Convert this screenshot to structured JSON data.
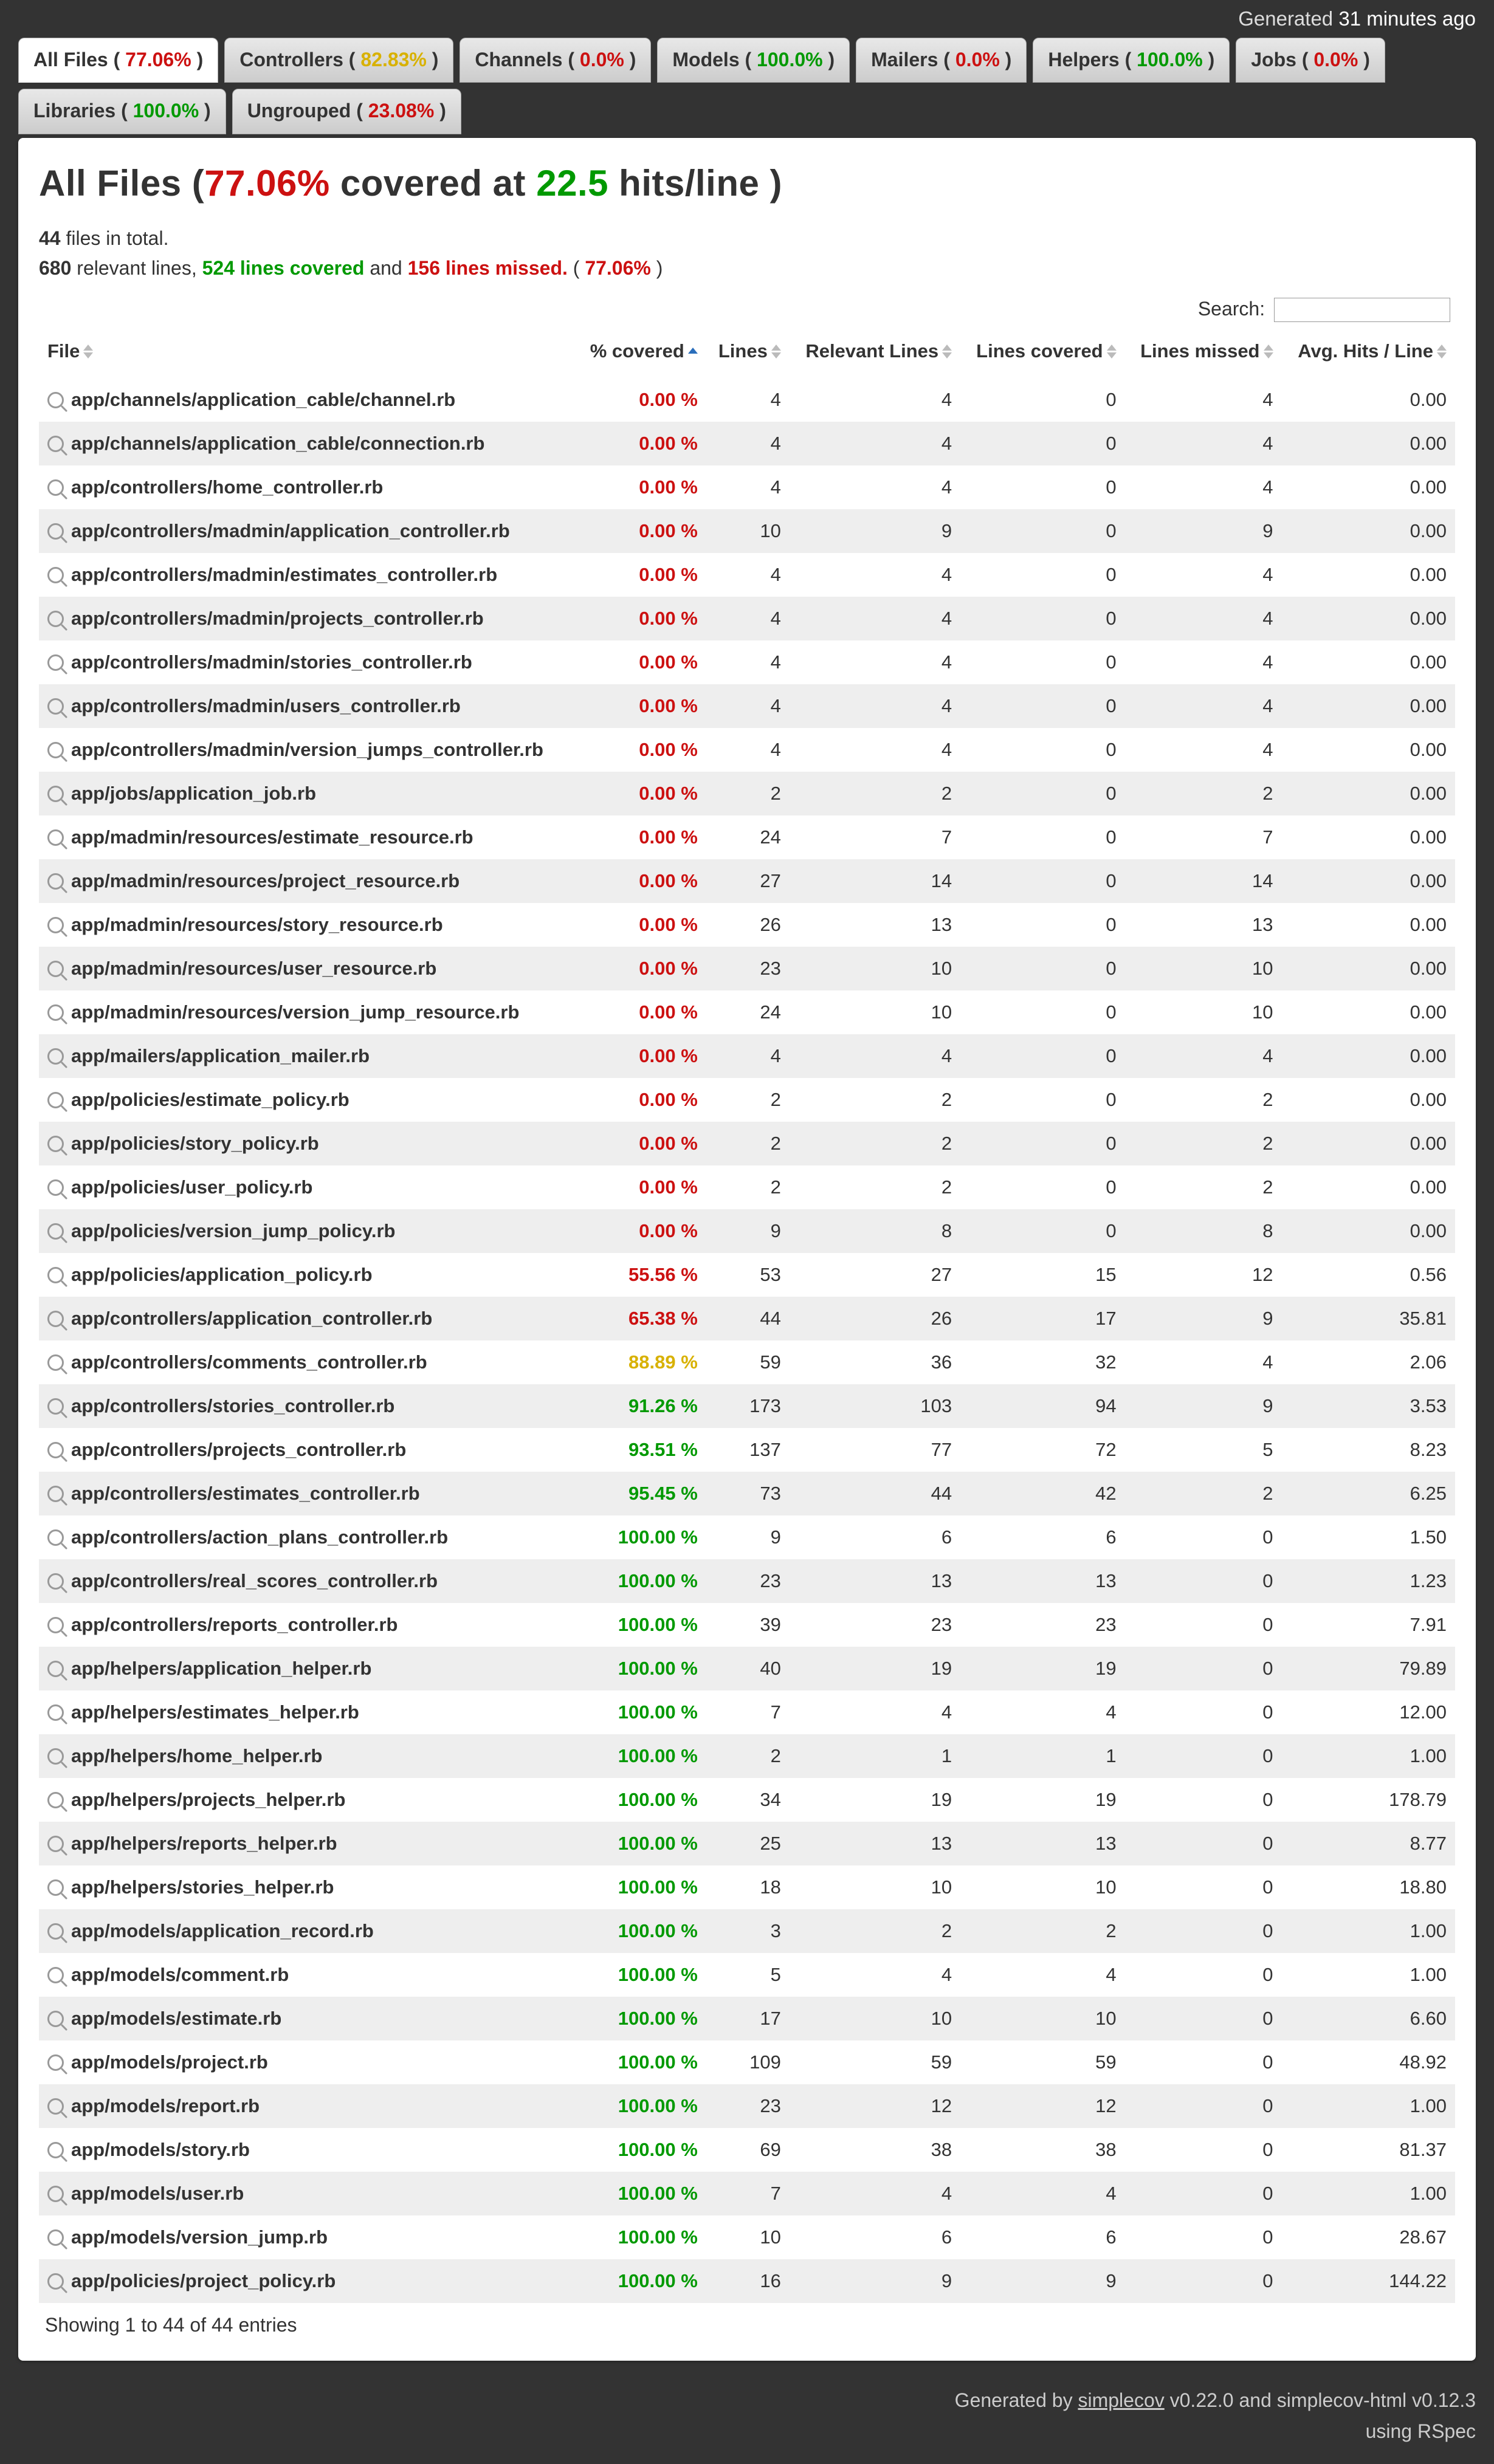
{
  "timestamp": {
    "prefix": "Generated",
    "ago": "31 minutes ago"
  },
  "tabs": [
    {
      "label": "All Files",
      "pct": "77.06%",
      "cls": "pct-red",
      "active": true
    },
    {
      "label": "Controllers",
      "pct": "82.83%",
      "cls": "pct-yellow"
    },
    {
      "label": "Channels",
      "pct": "0.0%",
      "cls": "pct-red"
    },
    {
      "label": "Models",
      "pct": "100.0%",
      "cls": "pct-green"
    },
    {
      "label": "Mailers",
      "pct": "0.0%",
      "cls": "pct-red"
    },
    {
      "label": "Helpers",
      "pct": "100.0%",
      "cls": "pct-green"
    },
    {
      "label": "Jobs",
      "pct": "0.0%",
      "cls": "pct-red"
    },
    {
      "label": "Libraries",
      "pct": "100.0%",
      "cls": "pct-green"
    },
    {
      "label": "Ungrouped",
      "pct": "23.08%",
      "cls": "pct-red"
    }
  ],
  "title": {
    "part1": "All Files (",
    "pct": "77.06%",
    "part2": " covered at ",
    "hits": "22.5",
    "part3": " hits/line )"
  },
  "sub1": {
    "count": "44",
    "suffix": " files in total."
  },
  "sub2": {
    "relevant": "680",
    "relevant_text": " relevant lines, ",
    "covered": "524 lines covered",
    "mid": " and ",
    "missed": "156 lines missed.",
    "tail_open": " ( ",
    "tail_pct": "77.06%",
    "tail_close": " )"
  },
  "search_label": "Search:",
  "columns": [
    "File",
    "% covered",
    "Lines",
    "Relevant Lines",
    "Lines covered",
    "Lines missed",
    "Avg. Hits / Line"
  ],
  "rows": [
    {
      "file": "app/channels/application_cable/channel.rb",
      "pct": "0.00 %",
      "pcls": "pct-red",
      "lines": "4",
      "rel": "4",
      "cov": "0",
      "miss": "4",
      "hits": "0.00"
    },
    {
      "file": "app/channels/application_cable/connection.rb",
      "pct": "0.00 %",
      "pcls": "pct-red",
      "lines": "4",
      "rel": "4",
      "cov": "0",
      "miss": "4",
      "hits": "0.00"
    },
    {
      "file": "app/controllers/home_controller.rb",
      "pct": "0.00 %",
      "pcls": "pct-red",
      "lines": "4",
      "rel": "4",
      "cov": "0",
      "miss": "4",
      "hits": "0.00"
    },
    {
      "file": "app/controllers/madmin/application_controller.rb",
      "pct": "0.00 %",
      "pcls": "pct-red",
      "lines": "10",
      "rel": "9",
      "cov": "0",
      "miss": "9",
      "hits": "0.00"
    },
    {
      "file": "app/controllers/madmin/estimates_controller.rb",
      "pct": "0.00 %",
      "pcls": "pct-red",
      "lines": "4",
      "rel": "4",
      "cov": "0",
      "miss": "4",
      "hits": "0.00"
    },
    {
      "file": "app/controllers/madmin/projects_controller.rb",
      "pct": "0.00 %",
      "pcls": "pct-red",
      "lines": "4",
      "rel": "4",
      "cov": "0",
      "miss": "4",
      "hits": "0.00"
    },
    {
      "file": "app/controllers/madmin/stories_controller.rb",
      "pct": "0.00 %",
      "pcls": "pct-red",
      "lines": "4",
      "rel": "4",
      "cov": "0",
      "miss": "4",
      "hits": "0.00"
    },
    {
      "file": "app/controllers/madmin/users_controller.rb",
      "pct": "0.00 %",
      "pcls": "pct-red",
      "lines": "4",
      "rel": "4",
      "cov": "0",
      "miss": "4",
      "hits": "0.00"
    },
    {
      "file": "app/controllers/madmin/version_jumps_controller.rb",
      "pct": "0.00 %",
      "pcls": "pct-red",
      "lines": "4",
      "rel": "4",
      "cov": "0",
      "miss": "4",
      "hits": "0.00"
    },
    {
      "file": "app/jobs/application_job.rb",
      "pct": "0.00 %",
      "pcls": "pct-red",
      "lines": "2",
      "rel": "2",
      "cov": "0",
      "miss": "2",
      "hits": "0.00"
    },
    {
      "file": "app/madmin/resources/estimate_resource.rb",
      "pct": "0.00 %",
      "pcls": "pct-red",
      "lines": "24",
      "rel": "7",
      "cov": "0",
      "miss": "7",
      "hits": "0.00"
    },
    {
      "file": "app/madmin/resources/project_resource.rb",
      "pct": "0.00 %",
      "pcls": "pct-red",
      "lines": "27",
      "rel": "14",
      "cov": "0",
      "miss": "14",
      "hits": "0.00"
    },
    {
      "file": "app/madmin/resources/story_resource.rb",
      "pct": "0.00 %",
      "pcls": "pct-red",
      "lines": "26",
      "rel": "13",
      "cov": "0",
      "miss": "13",
      "hits": "0.00"
    },
    {
      "file": "app/madmin/resources/user_resource.rb",
      "pct": "0.00 %",
      "pcls": "pct-red",
      "lines": "23",
      "rel": "10",
      "cov": "0",
      "miss": "10",
      "hits": "0.00"
    },
    {
      "file": "app/madmin/resources/version_jump_resource.rb",
      "pct": "0.00 %",
      "pcls": "pct-red",
      "lines": "24",
      "rel": "10",
      "cov": "0",
      "miss": "10",
      "hits": "0.00"
    },
    {
      "file": "app/mailers/application_mailer.rb",
      "pct": "0.00 %",
      "pcls": "pct-red",
      "lines": "4",
      "rel": "4",
      "cov": "0",
      "miss": "4",
      "hits": "0.00"
    },
    {
      "file": "app/policies/estimate_policy.rb",
      "pct": "0.00 %",
      "pcls": "pct-red",
      "lines": "2",
      "rel": "2",
      "cov": "0",
      "miss": "2",
      "hits": "0.00"
    },
    {
      "file": "app/policies/story_policy.rb",
      "pct": "0.00 %",
      "pcls": "pct-red",
      "lines": "2",
      "rel": "2",
      "cov": "0",
      "miss": "2",
      "hits": "0.00"
    },
    {
      "file": "app/policies/user_policy.rb",
      "pct": "0.00 %",
      "pcls": "pct-red",
      "lines": "2",
      "rel": "2",
      "cov": "0",
      "miss": "2",
      "hits": "0.00"
    },
    {
      "file": "app/policies/version_jump_policy.rb",
      "pct": "0.00 %",
      "pcls": "pct-red",
      "lines": "9",
      "rel": "8",
      "cov": "0",
      "miss": "8",
      "hits": "0.00"
    },
    {
      "file": "app/policies/application_policy.rb",
      "pct": "55.56 %",
      "pcls": "pct-red",
      "lines": "53",
      "rel": "27",
      "cov": "15",
      "miss": "12",
      "hits": "0.56"
    },
    {
      "file": "app/controllers/application_controller.rb",
      "pct": "65.38 %",
      "pcls": "pct-red",
      "lines": "44",
      "rel": "26",
      "cov": "17",
      "miss": "9",
      "hits": "35.81"
    },
    {
      "file": "app/controllers/comments_controller.rb",
      "pct": "88.89 %",
      "pcls": "pct-yellow",
      "lines": "59",
      "rel": "36",
      "cov": "32",
      "miss": "4",
      "hits": "2.06"
    },
    {
      "file": "app/controllers/stories_controller.rb",
      "pct": "91.26 %",
      "pcls": "pct-green",
      "lines": "173",
      "rel": "103",
      "cov": "94",
      "miss": "9",
      "hits": "3.53"
    },
    {
      "file": "app/controllers/projects_controller.rb",
      "pct": "93.51 %",
      "pcls": "pct-green",
      "lines": "137",
      "rel": "77",
      "cov": "72",
      "miss": "5",
      "hits": "8.23"
    },
    {
      "file": "app/controllers/estimates_controller.rb",
      "pct": "95.45 %",
      "pcls": "pct-green",
      "lines": "73",
      "rel": "44",
      "cov": "42",
      "miss": "2",
      "hits": "6.25"
    },
    {
      "file": "app/controllers/action_plans_controller.rb",
      "pct": "100.00 %",
      "pcls": "pct-green",
      "lines": "9",
      "rel": "6",
      "cov": "6",
      "miss": "0",
      "hits": "1.50"
    },
    {
      "file": "app/controllers/real_scores_controller.rb",
      "pct": "100.00 %",
      "pcls": "pct-green",
      "lines": "23",
      "rel": "13",
      "cov": "13",
      "miss": "0",
      "hits": "1.23"
    },
    {
      "file": "app/controllers/reports_controller.rb",
      "pct": "100.00 %",
      "pcls": "pct-green",
      "lines": "39",
      "rel": "23",
      "cov": "23",
      "miss": "0",
      "hits": "7.91"
    },
    {
      "file": "app/helpers/application_helper.rb",
      "pct": "100.00 %",
      "pcls": "pct-green",
      "lines": "40",
      "rel": "19",
      "cov": "19",
      "miss": "0",
      "hits": "79.89"
    },
    {
      "file": "app/helpers/estimates_helper.rb",
      "pct": "100.00 %",
      "pcls": "pct-green",
      "lines": "7",
      "rel": "4",
      "cov": "4",
      "miss": "0",
      "hits": "12.00"
    },
    {
      "file": "app/helpers/home_helper.rb",
      "pct": "100.00 %",
      "pcls": "pct-green",
      "lines": "2",
      "rel": "1",
      "cov": "1",
      "miss": "0",
      "hits": "1.00"
    },
    {
      "file": "app/helpers/projects_helper.rb",
      "pct": "100.00 %",
      "pcls": "pct-green",
      "lines": "34",
      "rel": "19",
      "cov": "19",
      "miss": "0",
      "hits": "178.79"
    },
    {
      "file": "app/helpers/reports_helper.rb",
      "pct": "100.00 %",
      "pcls": "pct-green",
      "lines": "25",
      "rel": "13",
      "cov": "13",
      "miss": "0",
      "hits": "8.77"
    },
    {
      "file": "app/helpers/stories_helper.rb",
      "pct": "100.00 %",
      "pcls": "pct-green",
      "lines": "18",
      "rel": "10",
      "cov": "10",
      "miss": "0",
      "hits": "18.80"
    },
    {
      "file": "app/models/application_record.rb",
      "pct": "100.00 %",
      "pcls": "pct-green",
      "lines": "3",
      "rel": "2",
      "cov": "2",
      "miss": "0",
      "hits": "1.00"
    },
    {
      "file": "app/models/comment.rb",
      "pct": "100.00 %",
      "pcls": "pct-green",
      "lines": "5",
      "rel": "4",
      "cov": "4",
      "miss": "0",
      "hits": "1.00"
    },
    {
      "file": "app/models/estimate.rb",
      "pct": "100.00 %",
      "pcls": "pct-green",
      "lines": "17",
      "rel": "10",
      "cov": "10",
      "miss": "0",
      "hits": "6.60"
    },
    {
      "file": "app/models/project.rb",
      "pct": "100.00 %",
      "pcls": "pct-green",
      "lines": "109",
      "rel": "59",
      "cov": "59",
      "miss": "0",
      "hits": "48.92"
    },
    {
      "file": "app/models/report.rb",
      "pct": "100.00 %",
      "pcls": "pct-green",
      "lines": "23",
      "rel": "12",
      "cov": "12",
      "miss": "0",
      "hits": "1.00"
    },
    {
      "file": "app/models/story.rb",
      "pct": "100.00 %",
      "pcls": "pct-green",
      "lines": "69",
      "rel": "38",
      "cov": "38",
      "miss": "0",
      "hits": "81.37"
    },
    {
      "file": "app/models/user.rb",
      "pct": "100.00 %",
      "pcls": "pct-green",
      "lines": "7",
      "rel": "4",
      "cov": "4",
      "miss": "0",
      "hits": "1.00"
    },
    {
      "file": "app/models/version_jump.rb",
      "pct": "100.00 %",
      "pcls": "pct-green",
      "lines": "10",
      "rel": "6",
      "cov": "6",
      "miss": "0",
      "hits": "28.67"
    },
    {
      "file": "app/policies/project_policy.rb",
      "pct": "100.00 %",
      "pcls": "pct-green",
      "lines": "16",
      "rel": "9",
      "cov": "9",
      "miss": "0",
      "hits": "144.22"
    }
  ],
  "footer_info": "Showing 1 to 44 of 44 entries",
  "footer": {
    "line1a": "Generated by ",
    "link": "simplecov",
    "line1b": " v0.22.0 and simplecov-html v0.12.3",
    "line2": "using RSpec"
  }
}
